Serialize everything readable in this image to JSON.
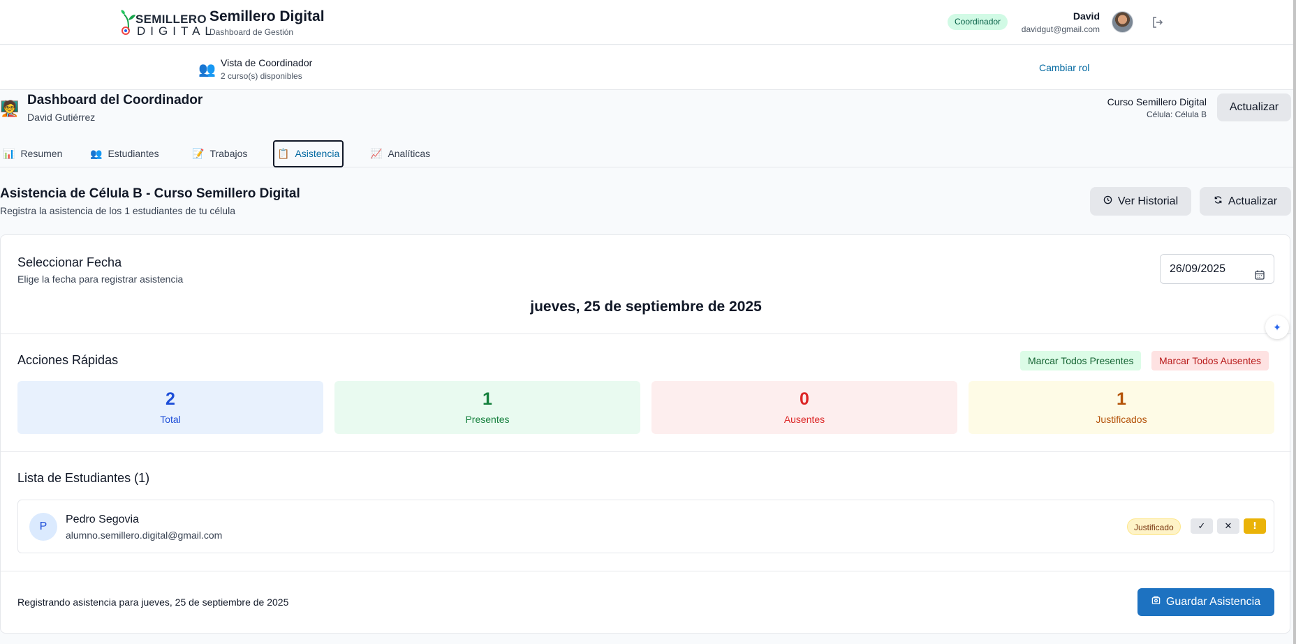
{
  "app": {
    "logo_top": "SEMILLERO",
    "logo_bottom": "DIGITAL",
    "title": "Semillero Digital",
    "subtitle": "Dashboard de Gestión"
  },
  "user": {
    "role_badge": "Coordinador",
    "name": "David",
    "email": "davidgut@gmail.com"
  },
  "role_bar": {
    "icon": "👥",
    "title": "Vista de Coordinador",
    "count": "2 curso(s) disponibles",
    "change_role": "Cambiar rol"
  },
  "dashboard": {
    "icon": "🧑‍🏫",
    "title": "Dashboard del Coordinador",
    "user": "David Gutiérrez",
    "course": "Curso Semillero Digital",
    "cell": "Célula: Célula B",
    "refresh_label": "Actualizar"
  },
  "tabs": [
    {
      "icon": "📊",
      "label": "Resumen"
    },
    {
      "icon": "👥",
      "label": "Estudiantes"
    },
    {
      "icon": "📝",
      "label": "Trabajos"
    },
    {
      "icon": "📋",
      "label": "Asistencia"
    },
    {
      "icon": "📈",
      "label": "Analíticas"
    }
  ],
  "attendance": {
    "title": "Asistencia de Célula B - Curso Semillero Digital",
    "subtitle": "Registra la asistencia de los 1 estudiantes de tu célula",
    "history_label": "Ver Historial",
    "refresh_label": "Actualizar",
    "date_section": {
      "title": "Seleccionar Fecha",
      "subtitle": "Elige la fecha para registrar asistencia",
      "value": "26/09/2025",
      "long_date": "jueves, 25 de septiembre de 2025"
    },
    "quick_actions": {
      "title": "Acciones Rápidas",
      "mark_present": "Marcar Todos Presentes",
      "mark_absent": "Marcar Todos Ausentes"
    },
    "stats": [
      {
        "value": "2",
        "label": "Total"
      },
      {
        "value": "1",
        "label": "Presentes"
      },
      {
        "value": "0",
        "label": "Ausentes"
      },
      {
        "value": "1",
        "label": "Justificados"
      }
    ],
    "list": {
      "title": "Lista de Estudiantes (1)",
      "students": [
        {
          "initial": "P",
          "name": "Pedro Segovia",
          "email": "alumno.semillero.digital@gmail.com",
          "status": "Justificado",
          "btn_present": "✓",
          "btn_absent": "✕",
          "btn_justified": "!"
        }
      ]
    },
    "footer": {
      "text": "Registrando asistencia para jueves, 25 de septiembre de 2025",
      "save_label": "Guardar Asistencia"
    }
  },
  "colors": {
    "accent": "#1d72c1",
    "link": "#0369a1",
    "present": "#15803d",
    "absent": "#dc2626",
    "justified": "#b45309",
    "total": "#1d4ed8"
  },
  "icons": {
    "logout": "logout-icon",
    "history": "clock-icon",
    "refresh": "refresh-icon",
    "calendar": "calendar-icon",
    "save": "save-icon",
    "assistant": "sparkle-icon"
  }
}
